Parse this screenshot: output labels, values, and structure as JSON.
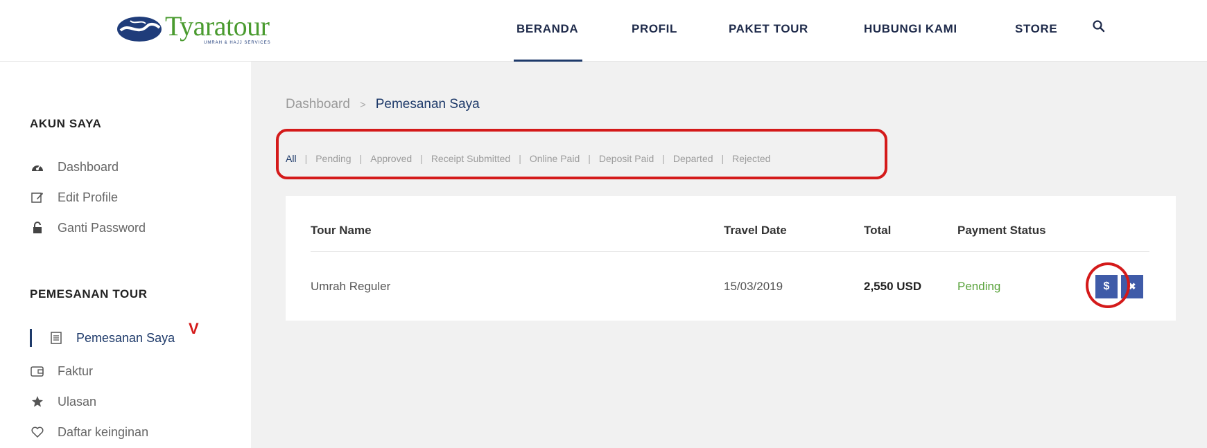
{
  "header": {
    "logo_text": "Tyaratour",
    "logo_subtext": "UMRAH & HAJJ SERVICES",
    "nav": [
      {
        "label": "BERANDA",
        "active": true
      },
      {
        "label": "PROFIL",
        "active": false
      },
      {
        "label": "PAKET TOUR",
        "active": false
      },
      {
        "label": "HUBUNGI KAMI",
        "active": false
      },
      {
        "label": "STORE",
        "active": false
      }
    ],
    "search_icon": "search-icon"
  },
  "sidebar": {
    "account_heading": "AKUN SAYA",
    "account_items": [
      {
        "label": "Dashboard",
        "icon": "dashboard-gauge-icon"
      },
      {
        "label": "Edit Profile",
        "icon": "edit-icon"
      },
      {
        "label": "Ganti Password",
        "icon": "lock-icon"
      }
    ],
    "tour_heading": "PEMESANAN TOUR",
    "tour_items": [
      {
        "label": "Pemesanan Saya",
        "icon": "document-icon",
        "active": true
      },
      {
        "label": "Faktur",
        "icon": "wallet-icon"
      },
      {
        "label": "Ulasan",
        "icon": "star-icon"
      },
      {
        "label": "Daftar keinginan",
        "icon": "heart-icon"
      }
    ],
    "annotation_mark": "V"
  },
  "main": {
    "breadcrumb": {
      "home": "Dashboard",
      "separator": ">",
      "current": "Pemesanan Saya"
    },
    "filters": [
      "All",
      "Pending",
      "Approved",
      "Receipt Submitted",
      "Online Paid",
      "Deposit Paid",
      "Departed",
      "Rejected"
    ],
    "filter_separator": "|",
    "table": {
      "headers": [
        "Tour Name",
        "Travel Date",
        "Total",
        "Payment Status"
      ],
      "rows": [
        {
          "tour_name": "Umrah Reguler",
          "travel_date": "15/03/2019",
          "total": "2,550 USD",
          "status": "Pending",
          "pay_label": "$",
          "cancel_label": "✖"
        }
      ]
    }
  },
  "colors": {
    "accent": "#1e3a6a",
    "annotation_red": "#d41a1a",
    "status_pending": "#5aa33c",
    "button_blue": "#3f5ba8",
    "logo_green": "#4a9b2f"
  }
}
